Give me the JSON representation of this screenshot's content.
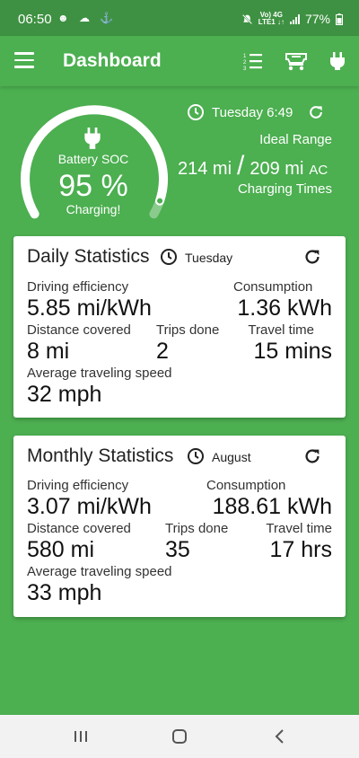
{
  "status_bar": {
    "time": "06:50",
    "left_icons": "☻ ☁ ⚓",
    "net_top": "Vo) 4G",
    "net_bottom": "LTE1 ↓↑",
    "battery_percent": "77%"
  },
  "app_bar": {
    "title": "Dashboard",
    "icons": [
      "menu-icon",
      "list-icon",
      "car-icon",
      "plug-icon"
    ]
  },
  "hero": {
    "soc_label": "Battery SOC",
    "soc_value": "95 %",
    "soc_fraction": 0.95,
    "soc_status": "Charging!",
    "updated": "Tuesday 6:49",
    "ideal_label": "Ideal Range",
    "range_primary": "214 mi",
    "range_separator": "/",
    "range_secondary": "209 mi",
    "range_mode": "AC",
    "charging_times": "Charging Times"
  },
  "daily": {
    "title": "Daily Statistics",
    "period": "Tuesday",
    "efficiency_label": "Driving efficiency",
    "efficiency_value": "5.85 mi/kWh",
    "consumption_label": "Consumption",
    "consumption_value": "1.36 kWh",
    "distance_label": "Distance covered",
    "distance_value": "8 mi",
    "trips_label": "Trips done",
    "trips_value": "2",
    "travel_label": "Travel time",
    "travel_value": "15 mins",
    "speed_label": "Average traveling speed",
    "speed_value": "32 mph"
  },
  "monthly": {
    "title": "Monthly Statistics",
    "period": "August",
    "efficiency_label": "Driving efficiency",
    "efficiency_value": "3.07 mi/kWh",
    "consumption_label": "Consumption",
    "consumption_value": "188.61 kWh",
    "distance_label": "Distance covered",
    "distance_value": "580 mi",
    "trips_label": "Trips done",
    "trips_value": "35",
    "travel_label": "Travel time",
    "travel_value": "17 hrs",
    "speed_label": "Average traveling speed",
    "speed_value": "33 mph"
  },
  "colors": {
    "primary": "#4caf50",
    "status_bar": "#3e9142",
    "card": "#ffffff"
  }
}
